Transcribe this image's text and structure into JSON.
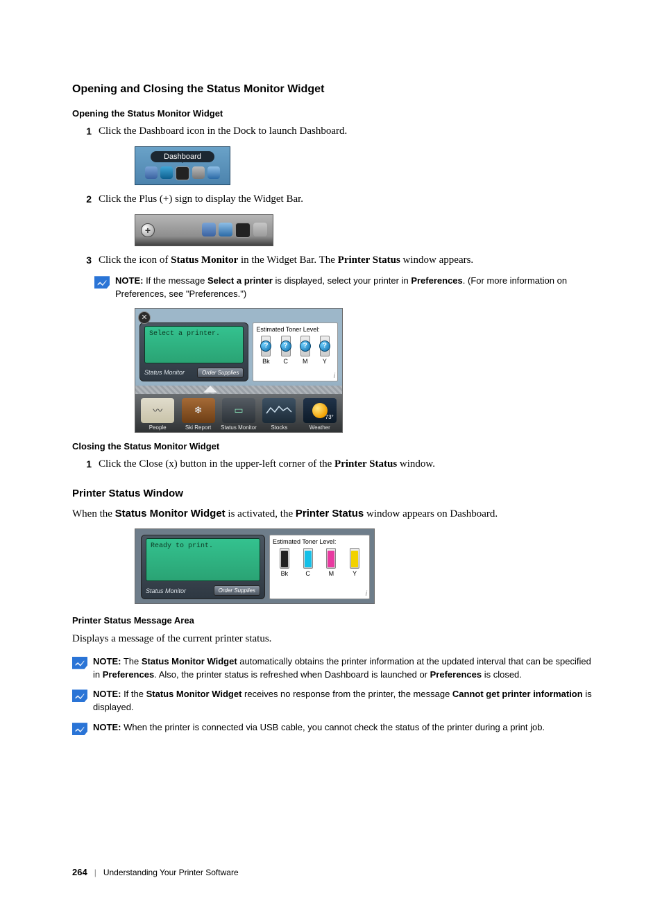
{
  "section1_title": "Opening and Closing the Status Monitor Widget",
  "sub_opening": "Opening the Status Monitor Widget",
  "steps_open": [
    {
      "num": "1",
      "text": "Click the Dashboard icon in the Dock to launch Dashboard."
    },
    {
      "num": "2",
      "text": "Click the Plus (+) sign to display the Widget Bar."
    },
    {
      "num": "3",
      "pre": "Click the icon of ",
      "b1": "Status Monitor",
      "mid": " in the Widget Bar. The ",
      "b2": "Printer Status",
      "post": " window appears."
    }
  ],
  "dashboard_tooltip": "Dashboard",
  "note_step3_a": "NOTE:",
  "note_step3_b": " If the message ",
  "note_step3_c": "Select a printer",
  "note_step3_d": " is displayed, select your printer in ",
  "note_step3_e": "Preferences",
  "note_step3_f": ". (For more information on Preferences, see \"Preferences.\")",
  "widget1": {
    "screen_msg": "Select a printer.",
    "panel_label": "Status Monitor",
    "order_btn": "Order Supplies",
    "toner_title": "Estimated Toner Level:",
    "toners": [
      "Bk",
      "C",
      "M",
      "Y"
    ],
    "tiles": [
      {
        "cap": "People"
      },
      {
        "cap": "Ski Report"
      },
      {
        "cap": "Status Monitor"
      },
      {
        "cap": "Stocks"
      },
      {
        "cap": "Weather",
        "temp": "73°"
      }
    ]
  },
  "sub_closing": "Closing the Status Monitor Widget",
  "steps_close": [
    {
      "num": "1",
      "pre": "Click the Close (x) button in the upper-left corner of the ",
      "b1": "Printer Status",
      "post": " window."
    }
  ],
  "topic_psw": "Printer Status Window",
  "psw_intro_a": "When the ",
  "psw_intro_b": "Status Monitor Widget",
  "psw_intro_c": " is activated, the ",
  "psw_intro_d": "Printer Status",
  "psw_intro_e": " window appears on Dashboard.",
  "widget2": {
    "screen_msg": "Ready to print.",
    "panel_label": "Status Monitor",
    "order_btn": "Order Supplies",
    "toner_title": "Estimated Toner Level:",
    "toners": [
      "Bk",
      "C",
      "M",
      "Y"
    ]
  },
  "sub_psma": "Printer Status Message Area",
  "psma_text": "Displays a message of the current printer status.",
  "note_a": {
    "label": "NOTE:",
    "t1": " The ",
    "b1": "Status Monitor Widget",
    "t2": " automatically obtains the printer information at the updated interval that can be specified in ",
    "b2": "Preferences",
    "t3": ". Also, the printer status is refreshed when Dashboard is launched or ",
    "b3": "Preferences",
    "t4": " is closed."
  },
  "note_b": {
    "label": "NOTE:",
    "t1": " If the ",
    "b1": "Status Monitor Widget",
    "t2": " receives no response from the printer, the message ",
    "b2": "Cannot get printer information",
    "t3": " is displayed."
  },
  "note_c": {
    "label": "NOTE:",
    "t1": " When the printer is connected via USB cable, you cannot check the status of the printer during a print job."
  },
  "footer": {
    "page": "264",
    "title": "Understanding Your Printer Software"
  }
}
